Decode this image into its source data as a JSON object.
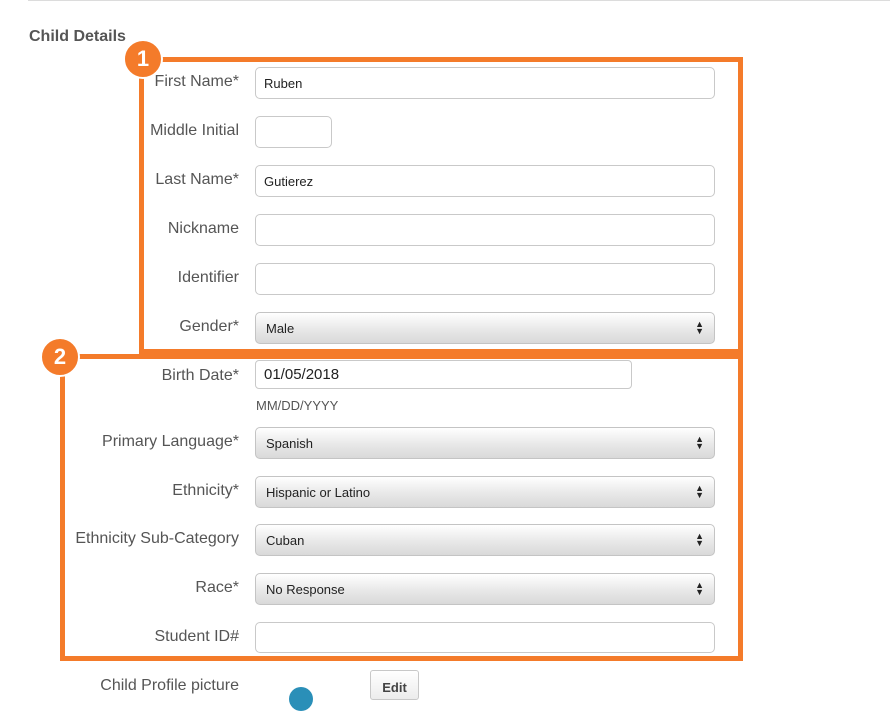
{
  "section_title": "Child Details",
  "badges": {
    "one": "1",
    "two": "2"
  },
  "fields": {
    "first_name": {
      "label": "First Name*",
      "value": "Ruben"
    },
    "middle_initial": {
      "label": "Middle Initial",
      "value": ""
    },
    "last_name": {
      "label": "Last Name*",
      "value": "Gutierez"
    },
    "nickname": {
      "label": "Nickname",
      "value": ""
    },
    "identifier": {
      "label": "Identifier",
      "value": ""
    },
    "gender": {
      "label": "Gender*",
      "value": "Male"
    },
    "birth_date": {
      "label": "Birth Date*",
      "value": "01/05/2018",
      "hint": "MM/DD/YYYY"
    },
    "primary_language": {
      "label": "Primary Language*",
      "value": "Spanish"
    },
    "ethnicity": {
      "label": "Ethnicity*",
      "value": "Hispanic or Latino"
    },
    "ethnicity_sub": {
      "label": "Ethnicity Sub-Category",
      "value": "Cuban"
    },
    "race": {
      "label": "Race*",
      "value": "No Response"
    },
    "student_id": {
      "label": "Student ID#",
      "value": ""
    },
    "profile_picture": {
      "label": "Child Profile picture",
      "edit_label": "Edit"
    }
  },
  "colors": {
    "highlight": "#f47b2a"
  }
}
